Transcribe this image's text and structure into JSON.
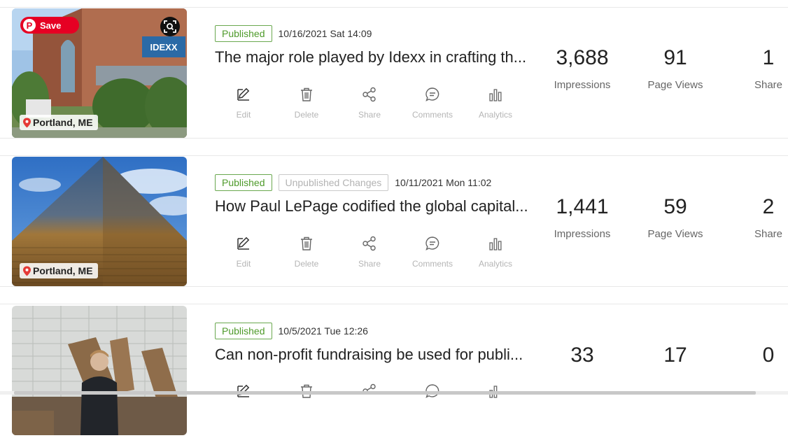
{
  "posts": [
    {
      "status": "Published",
      "unpublished_changes": null,
      "date": "10/16/2021 Sat 14:09",
      "title": "The major role played by Idexx in crafting th...",
      "location": "Portland, ME",
      "save_label": "Save",
      "impressions": "3,688",
      "page_views": "91",
      "shares": "1"
    },
    {
      "status": "Published",
      "unpublished_changes": "Unpublished Changes",
      "date": "10/11/2021 Mon 11:02",
      "title": "How Paul LePage codified the global capital...",
      "location": "Portland, ME",
      "impressions": "1,441",
      "page_views": "59",
      "shares": "2"
    },
    {
      "status": "Published",
      "unpublished_changes": null,
      "date": "10/5/2021 Tue 12:26",
      "title": "Can non-profit fundraising be used for publi...",
      "impressions": "33",
      "page_views": "17",
      "shares": "0"
    }
  ],
  "actions": {
    "edit": "Edit",
    "delete": "Delete",
    "share": "Share",
    "comments": "Comments",
    "analytics": "Analytics"
  },
  "stat_labels": {
    "impressions": "Impressions",
    "page_views": "Page Views",
    "share": "Share"
  },
  "icons": {
    "edit": "edit-icon",
    "delete": "trash-icon",
    "share": "share-icon",
    "comments": "comment-icon",
    "analytics": "bar-chart-icon",
    "location": "map-pin-icon",
    "pinterest": "pinterest-icon",
    "lens": "visual-search-icon"
  },
  "colors": {
    "published": "#4e9a2a",
    "unpublished": "#b3b3b3",
    "pinterest": "#e60023",
    "pin": "#e53935"
  }
}
